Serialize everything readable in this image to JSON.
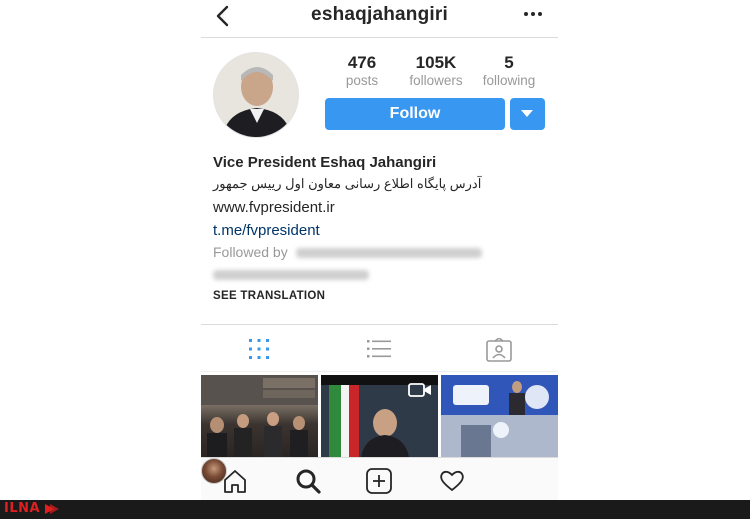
{
  "header": {
    "username": "eshaqjahangiri",
    "back_icon": "chevron-left-icon",
    "more_icon": "more-horizontal-icon"
  },
  "profile": {
    "stats": [
      {
        "value": "476",
        "label": "posts"
      },
      {
        "value": "105K",
        "label": "followers"
      },
      {
        "value": "5",
        "label": "following"
      }
    ],
    "follow_label": "Follow",
    "suggest_icon": "caret-down-icon",
    "accent_color": "#3897f0"
  },
  "bio": {
    "full_name": "Vice President Eshaq Jahangiri",
    "description": "آدرس پایگاه اطلاع رسانی معاون اول رییس جمهور",
    "website_text": "www.fvpresident.ir",
    "link": "t.me/fvpresident",
    "followed_by_prefix": "Followed by",
    "see_translation": "SEE TRANSLATION"
  },
  "tabs": [
    {
      "name": "grid",
      "icon": "grid-icon",
      "active": true
    },
    {
      "name": "list",
      "icon": "list-icon",
      "active": false
    },
    {
      "name": "tagged",
      "icon": "tagged-icon",
      "active": false
    }
  ],
  "posts": [
    {
      "icon": "photo-icon"
    },
    {
      "icon": "video-icon"
    },
    {
      "icon": "photo-icon"
    }
  ],
  "bottom_nav": [
    {
      "icon": "home-icon"
    },
    {
      "icon": "search-icon"
    },
    {
      "icon": "add-icon"
    },
    {
      "icon": "heart-icon"
    },
    {
      "icon": "profile-avatar"
    }
  ],
  "watermark": {
    "text": "ILNA",
    "color": "#e02020"
  }
}
